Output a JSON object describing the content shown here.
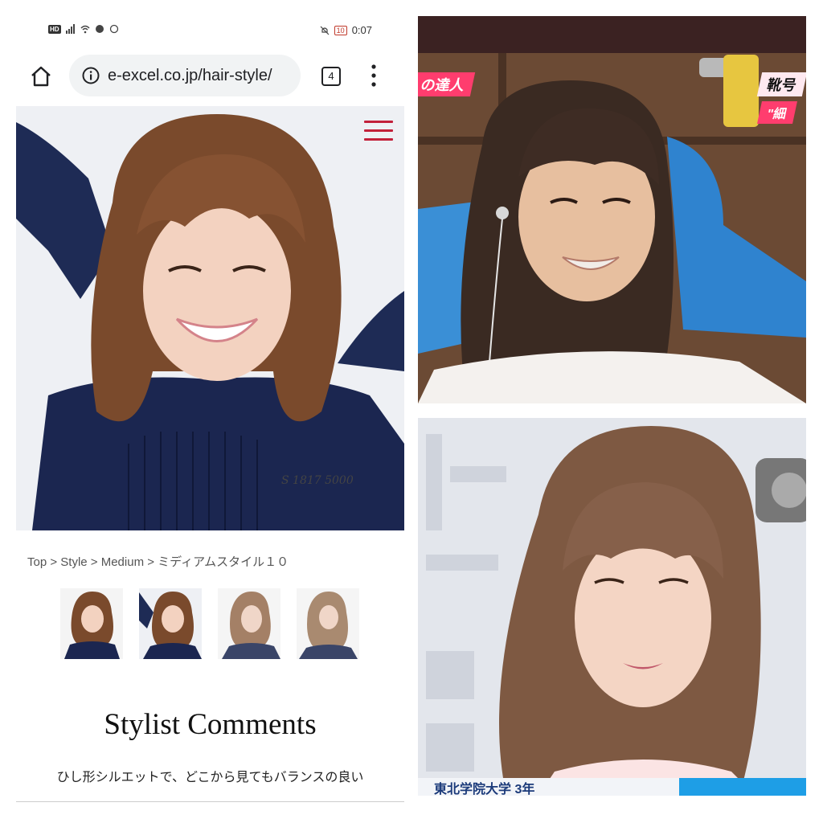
{
  "status_bar": {
    "left_badge": "HD",
    "battery": "10",
    "time": "0:07"
  },
  "browser": {
    "url": "e-excel.co.jp/hair-style/",
    "tab_count": "4"
  },
  "page": {
    "breadcrumb": "Top > Style > Medium > ミディアムスタイル１０",
    "section_title": "Stylist Comments",
    "comment": "ひし形シルエットで、どこから見てもバランスの良い",
    "hero_watermark": "S 1817 5000"
  },
  "tv_top": {
    "caption_left": "の達人",
    "caption_right": "靴号",
    "caption_right_sub": "\"細"
  },
  "tv_bottom": {
    "ticker": "東北学院大学 3年"
  },
  "colors": {
    "menu_accent": "#c2203a",
    "caption_pink": "#ff3d6e"
  }
}
